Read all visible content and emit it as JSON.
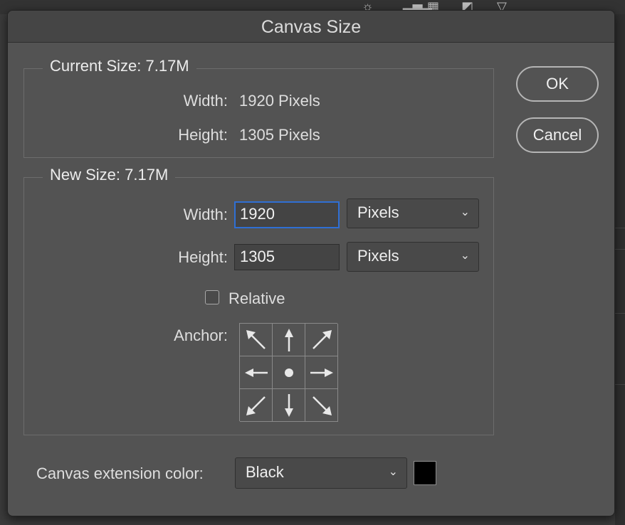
{
  "dialog": {
    "title": "Canvas Size"
  },
  "buttons": {
    "ok": "OK",
    "cancel": "Cancel"
  },
  "current_size": {
    "title": "Current Size: 7.17M",
    "width_label": "Width:",
    "width_value": "1920 Pixels",
    "height_label": "Height:",
    "height_value": "1305 Pixels"
  },
  "new_size": {
    "title": "New Size: 7.17M",
    "width_label": "Width:",
    "width_value": "1920",
    "width_unit": "Pixels",
    "height_label": "Height:",
    "height_value": "1305",
    "height_unit": "Pixels",
    "relative_label": "Relative",
    "relative_checked": false,
    "anchor_label": "Anchor:",
    "anchor_selected": "center"
  },
  "extension": {
    "label": "Canvas extension color:",
    "value": "Black",
    "swatch_color": "#000000"
  },
  "colors": {
    "focus_ring": "#2f6fd4",
    "dialog_bg": "#535353"
  }
}
